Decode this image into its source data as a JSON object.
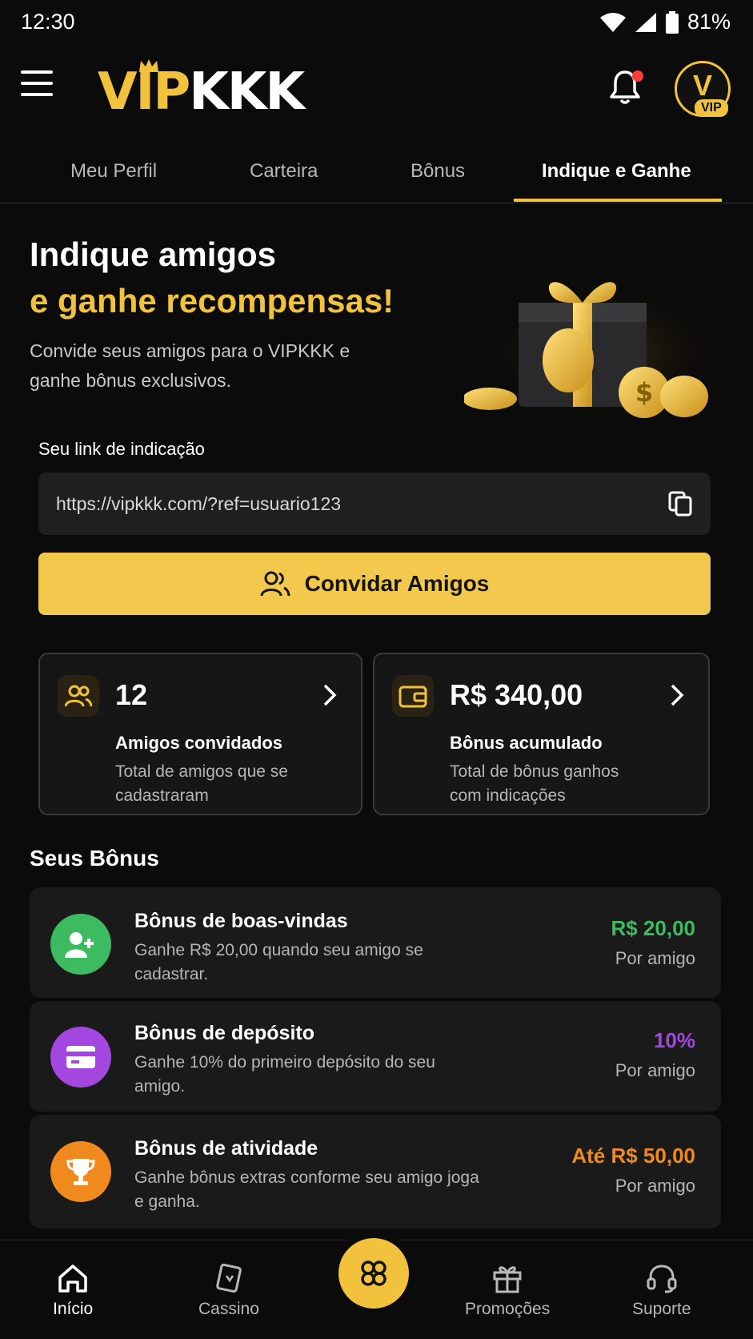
{
  "status_bar": {
    "time": "12:30",
    "battery": "81%"
  },
  "header": {
    "logo_vip": "VIP",
    "logo_kkk": "KKK",
    "avatar_letter": "V",
    "avatar_badge": "VIP"
  },
  "tabs": [
    {
      "label": "Meu Perfil",
      "active": false
    },
    {
      "label": "Carteira",
      "active": false
    },
    {
      "label": "Bônus",
      "active": false
    },
    {
      "label": "Indique e Ganhe",
      "active": true
    }
  ],
  "hero": {
    "title_line1": "Indique amigos",
    "title_line2": "e ganhe recompensas!",
    "subtitle": "Convide seus amigos para o VIPKKK e ganhe bônus exclusivos."
  },
  "referral": {
    "label": "Seu link de indicação",
    "link": "https://vipkkk.com/?ref=usuario123",
    "invite_button": "Convidar Amigos"
  },
  "stats": [
    {
      "value": "12",
      "title": "Amigos convidados",
      "description": "Total de amigos que se cadastraram"
    },
    {
      "value": "R$ 340,00",
      "title": "Bônus acumulado",
      "description": "Total de bônus ganhos com indicações"
    }
  ],
  "bonus_section": {
    "title": "Seus Bônus",
    "items": [
      {
        "title": "Bônus de boas-vindas",
        "description": "Ganhe R$ 20,00 quando seu amigo se cadastrar.",
        "value": "R$ 20,00",
        "per": "Por amigo",
        "color": "#3dbb61",
        "icon": "user-plus-icon"
      },
      {
        "title": "Bônus de depósito",
        "description": "Ganhe 10% do primeiro depósito do seu amigo.",
        "value": "10%",
        "per": "Por amigo",
        "color": "#a347e0",
        "icon": "card-icon"
      },
      {
        "title": "Bônus de atividade",
        "description": "Ganhe bônus extras conforme seu amigo joga e ganha.",
        "value": "Até R$ 50,00",
        "per": "Por amigo",
        "color": "#f08a1c",
        "icon": "trophy-icon"
      }
    ]
  },
  "bottom_nav": [
    {
      "label": "Início",
      "icon": "home-icon",
      "active": true
    },
    {
      "label": "Cassino",
      "icon": "cards-icon",
      "active": false
    },
    {
      "label": "Promoções",
      "icon": "gift-icon",
      "active": false
    },
    {
      "label": "Suporte",
      "icon": "headset-icon",
      "active": false
    }
  ],
  "colors": {
    "accent": "#f2c23c",
    "background": "#0b0b0b",
    "card": "#1a1a1a"
  }
}
